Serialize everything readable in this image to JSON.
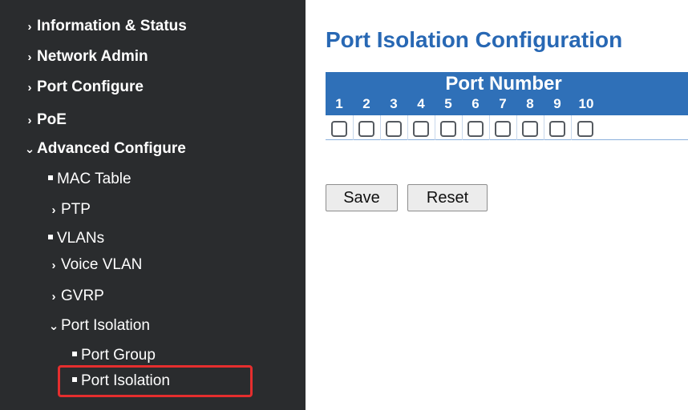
{
  "sidebar": {
    "items": [
      {
        "label": "Information & Status",
        "marker": "chevron-right-icon"
      },
      {
        "label": "Network Admin",
        "marker": "chevron-right-icon"
      },
      {
        "label": "Port Configure",
        "marker": "chevron-right-icon"
      },
      {
        "label": "PoE",
        "marker": "chevron-right-icon"
      },
      {
        "label": "Advanced Configure",
        "marker": "chevron-down-icon",
        "expanded": true
      },
      {
        "label": "MAC Table",
        "marker": "square-bullet-icon"
      },
      {
        "label": "PTP",
        "marker": "chevron-right-icon"
      },
      {
        "label": "VLANs",
        "marker": "square-bullet-icon"
      },
      {
        "label": "Voice VLAN",
        "marker": "chevron-right-icon"
      },
      {
        "label": "GVRP",
        "marker": "chevron-right-icon"
      },
      {
        "label": "Port Isolation",
        "marker": "chevron-down-icon",
        "expanded": true
      },
      {
        "label": "Port Group",
        "marker": "square-bullet-icon"
      },
      {
        "label": "Port Isolation",
        "marker": "square-bullet-icon",
        "selected": true
      }
    ],
    "highlight_color": "#e52e2e"
  },
  "main": {
    "title": "Port Isolation Configuration",
    "table": {
      "header": "Port Number",
      "ports": [
        "1",
        "2",
        "3",
        "4",
        "5",
        "6",
        "7",
        "8",
        "9",
        "10"
      ],
      "checked": [
        false,
        false,
        false,
        false,
        false,
        false,
        false,
        false,
        false,
        false
      ]
    },
    "buttons": {
      "save": "Save",
      "reset": "Reset"
    }
  },
  "colors": {
    "sidebar_bg": "#2a2c2e",
    "title": "#2868b4",
    "table_header_bg": "#2f70b8"
  }
}
